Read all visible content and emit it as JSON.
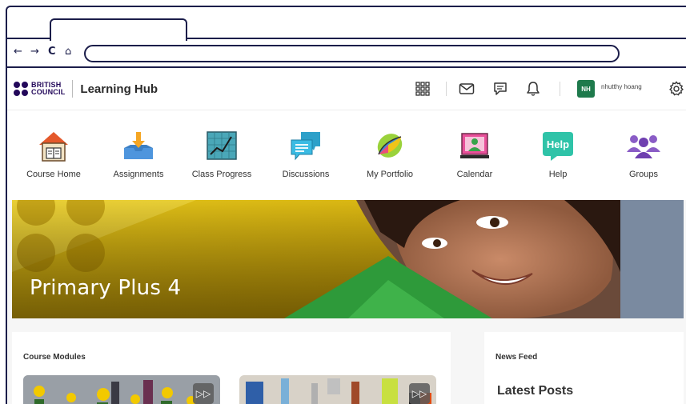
{
  "browser": {
    "back_glyph": "←",
    "forward_glyph": "→",
    "reload_glyph": "C",
    "home_glyph": "⌂",
    "url": ""
  },
  "header": {
    "logo_line1": "BRITISH",
    "logo_line2": "COUNCIL",
    "title": "Learning Hub",
    "user_initials": "NH",
    "user_name": "nhutthy hoang"
  },
  "nav": {
    "items": [
      {
        "label": "Course Home",
        "icon": "course-home-icon"
      },
      {
        "label": "Assignments",
        "icon": "assignments-icon"
      },
      {
        "label": "Class Progress",
        "icon": "class-progress-icon"
      },
      {
        "label": "Discussions",
        "icon": "discussions-icon"
      },
      {
        "label": "My Portfolio",
        "icon": "portfolio-icon"
      },
      {
        "label": "Calendar",
        "icon": "calendar-icon"
      },
      {
        "label": "Help",
        "icon": "help-icon"
      },
      {
        "label": "Groups",
        "icon": "groups-icon"
      }
    ],
    "help_badge": "Help"
  },
  "banner": {
    "title": "Primary Plus 4"
  },
  "modules": {
    "heading": "Course Modules"
  },
  "news": {
    "heading": "News Feed",
    "latest": "Latest Posts"
  },
  "colors": {
    "frame": "#1b1d4a",
    "brand": "#23085a",
    "avatar": "#1e7a4c",
    "banner_yellow": "#d8b200",
    "banner_green": "#2e9a3a"
  }
}
